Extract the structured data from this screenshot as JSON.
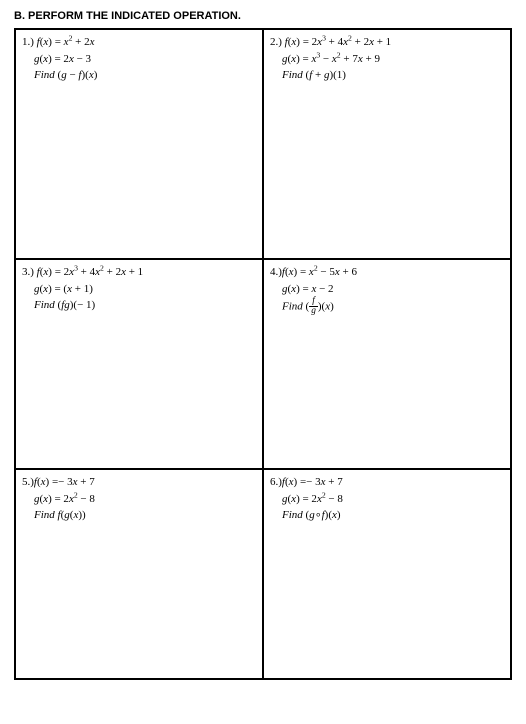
{
  "title": "B. PERFORM THE INDICATED OPERATION.",
  "problems": {
    "p1": {
      "num": "1.)",
      "l1_html": "<i>f</i>(<i>x</i>) = <i>x</i><sup>2</sup> + 2<i>x</i>",
      "l2_html": "<i>g</i>(<i>x</i>) = 2<i>x</i> − 3",
      "l3_html": "<i>Find</i> (<i>g</i> − <i>f</i>)(<i>x</i>)"
    },
    "p2": {
      "num": "2.)",
      "l1_html": "<i>f</i>(<i>x</i>) = 2<i>x</i><sup>3</sup> + 4<i>x</i><sup>2</sup> + 2<i>x</i> + 1",
      "l2_html": "<i>g</i>(<i>x</i>) = <i>x</i><sup>3</sup> − <i>x</i><sup>2</sup> + 7<i>x</i> + 9",
      "l3_html": "<i>Find</i> (<i>f</i> + <i>g</i>)(1)"
    },
    "p3": {
      "num": "3.)",
      "l1_html": "<i>f</i>(<i>x</i>) = 2<i>x</i><sup>3</sup> + 4<i>x</i><sup>2</sup> + 2<i>x</i> + 1",
      "l2_html": "<i>g</i>(<i>x</i>) = (<i>x</i> + 1)",
      "l3_html": "<i>Find</i> (<i>fg</i>)(− 1)"
    },
    "p4": {
      "num": "4.)",
      "l1_html": "<i>f</i>(<i>x</i>) = <i>x</i><sup>2</sup> − 5<i>x</i> + 6",
      "l2_html": "<i>g</i>(<i>x</i>) = <i>x</i> − 2",
      "l3_html": "<i>Find</i> (<span class=\"frac\"><span class=\"num\"><i>f</i></span><span class=\"den\"><i>g</i></span></span>)(<i>x</i>)"
    },
    "p5": {
      "num": "5.)",
      "l1_html": "<i>f</i>(<i>x</i>) =− 3<i>x</i> + 7",
      "l2_html": "<i>g</i>(<i>x</i>) = 2<i>x</i><sup>2</sup> − 8",
      "l3_html": "<i>Find f</i>(<i>g</i>(<i>x</i>))"
    },
    "p6": {
      "num": "6.)",
      "l1_html": "<i>f</i>(<i>x</i>) =− 3<i>x</i> + 7",
      "l2_html": "<i>g</i>(<i>x</i>) = 2<i>x</i><sup>2</sup> − 8",
      "l3_html": "<i>Find</i> (<i>g</i>∘<i>f</i>)(<i>x</i>)"
    }
  }
}
